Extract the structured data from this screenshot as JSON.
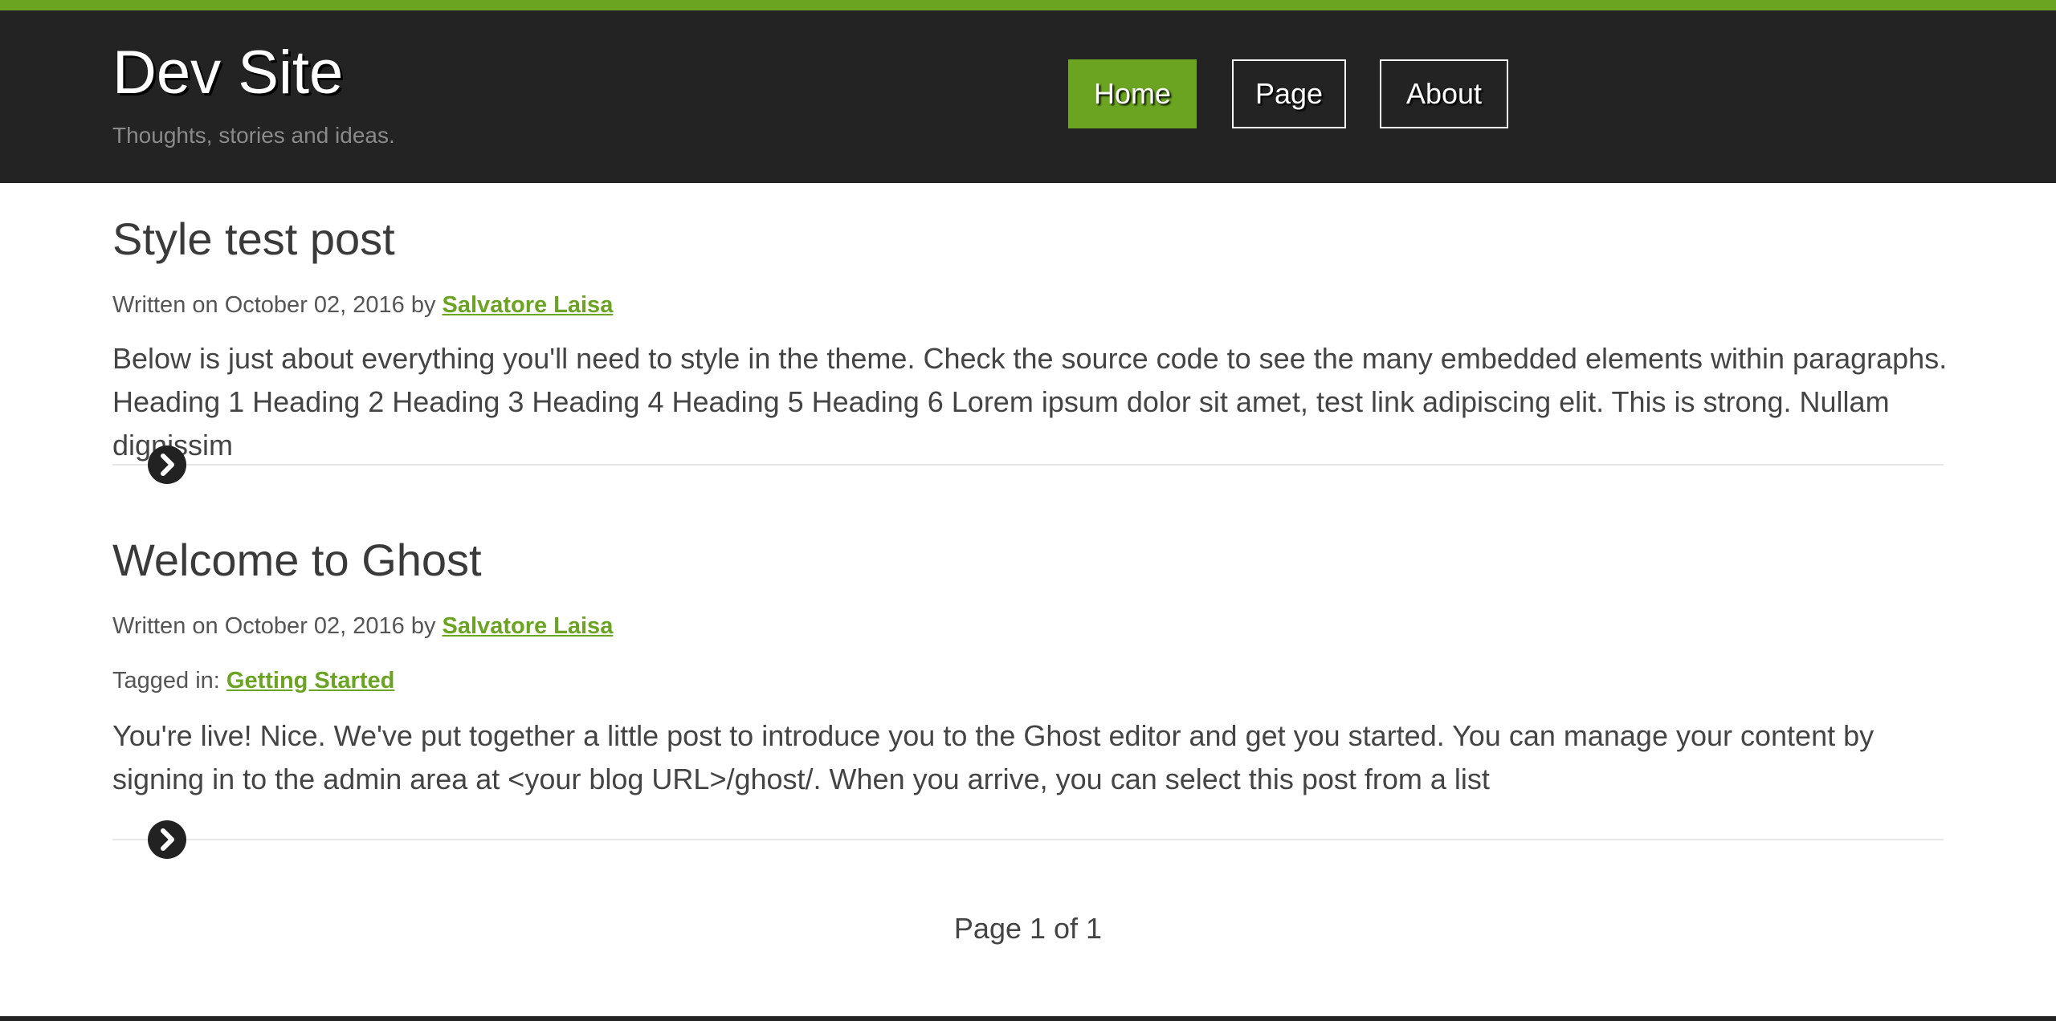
{
  "site": {
    "title": "Dev Site",
    "tagline": "Thoughts, stories and ideas.",
    "accent_color": "#6aa421",
    "header_color": "#232323"
  },
  "nav": {
    "items": [
      {
        "label": "Home",
        "active": true
      },
      {
        "label": "Page",
        "active": false
      },
      {
        "label": "About",
        "active": false
      }
    ]
  },
  "posts": [
    {
      "title": "Style test post",
      "meta_prefix": "Written on October 02, 2016 by ",
      "author": "Salvatore Laisa",
      "excerpt": "Below is just about everything you'll need to style in the theme. Check the source code to see the many embedded elements within paragraphs. Heading 1 Heading 2 Heading 3 Heading 4 Heading 5 Heading 6 Lorem ipsum dolor sit amet, test link adipiscing elit. This is strong. Nullam dignissim",
      "read_more_icon": "chevron-right-circle-icon"
    },
    {
      "title": "Welcome to Ghost",
      "meta_prefix": "Written on October 02, 2016 by ",
      "author": "Salvatore Laisa",
      "tags_prefix": "Tagged in: ",
      "tag": "Getting Started",
      "excerpt": "You're live! Nice. We've put together a little post to introduce you to the Ghost editor and get you started. You can manage your content by signing in to the admin area at <your blog URL>/ghost/. When you arrive, you can select this post from a list",
      "read_more_icon": "chevron-right-circle-icon"
    }
  ],
  "pagination": {
    "text": "Page 1 of 1"
  }
}
